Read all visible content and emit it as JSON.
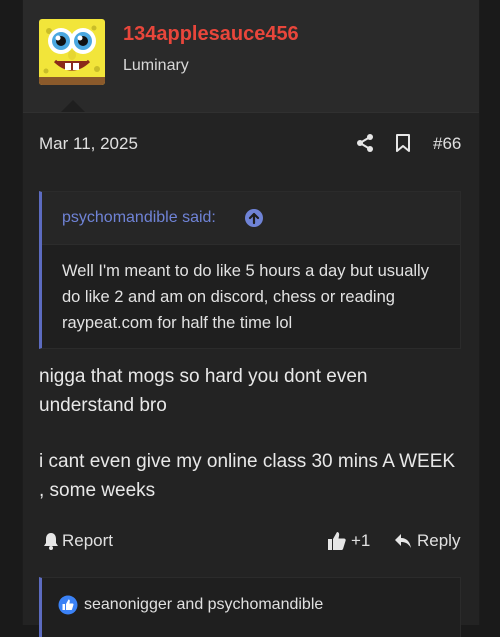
{
  "user": {
    "name": "134applesauce456",
    "title": "Luminary",
    "avatar": "spongebob-avatar"
  },
  "post": {
    "date": "Mar 11, 2025",
    "number": "#66",
    "quote": {
      "author": "psychomandible said:",
      "text": "Well I'm meant to do like 5 hours a day but usually do like 2 and am on discord, chess or reading raypeat.com for half the time lol"
    },
    "message": [
      "nigga that mogs so hard you dont even understand bro",
      "i cant even give my online class 30 mins A WEEK , some weeks"
    ]
  },
  "actions": {
    "report": "Report",
    "like_count": "+1",
    "reply": "Reply"
  },
  "reactions": {
    "text": "seanonigger and psychomandible"
  },
  "colors": {
    "username": "#e8463b",
    "accent": "#5c6bc0",
    "quote_author": "#6f83d6",
    "reaction_blue": "#3b82f6"
  },
  "icons": [
    "share-icon",
    "bookmark-icon",
    "arrow-up-circle-icon",
    "bell-icon",
    "thumbs-up-icon",
    "reply-arrow-icon",
    "like-reaction-icon"
  ]
}
